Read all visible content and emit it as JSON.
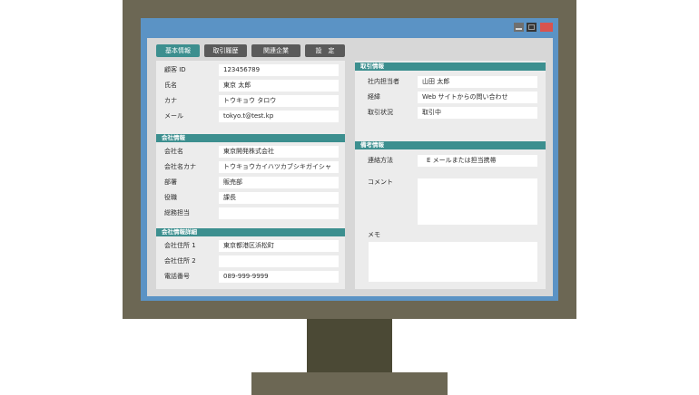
{
  "tabs": [
    "基本情報",
    "取引履歴",
    "関連企業",
    "設　定"
  ],
  "customer": {
    "fields": [
      {
        "label": "顧客 ID",
        "value": "123456789"
      },
      {
        "label": "氏名",
        "value": "東京 太郎"
      },
      {
        "label": "カナ",
        "value": "トウキョウ タロウ"
      },
      {
        "label": "メール",
        "value": "tokyo.t@test.kp"
      }
    ]
  },
  "company": {
    "title": "会社情報",
    "fields": [
      {
        "label": "会社名",
        "value": "東京開発株式会社"
      },
      {
        "label": "会社名カナ",
        "value": "トウキョウカイハツカブシキガイシャ"
      },
      {
        "label": "部署",
        "value": "販売部"
      },
      {
        "label": "役職",
        "value": "課長"
      },
      {
        "label": "総務担当",
        "value": ""
      }
    ]
  },
  "company_detail": {
    "title": "会社情報詳細",
    "fields": [
      {
        "label": "会社住所 1",
        "value": "東京都港区浜松町"
      },
      {
        "label": "会社住所 2",
        "value": ""
      },
      {
        "label": "電話番号",
        "value": "089-999-9999"
      }
    ]
  },
  "transaction": {
    "title": "取引情報",
    "fields": [
      {
        "label": "社内担当者",
        "value": "山田 太郎"
      },
      {
        "label": "経緯",
        "value": "Web サイトからの問い合わせ"
      },
      {
        "label": "取引状況",
        "value": "取引中"
      }
    ]
  },
  "notes": {
    "title": "備考情報",
    "contact_label": "連絡方法",
    "contact_value": "E メールまたは担当携帯",
    "comment_label": "コメント",
    "memo_label": "メモ"
  },
  "colors": {
    "accent": "#3c8f8f",
    "screen": "#5b93c5",
    "close": "#d9534f"
  }
}
